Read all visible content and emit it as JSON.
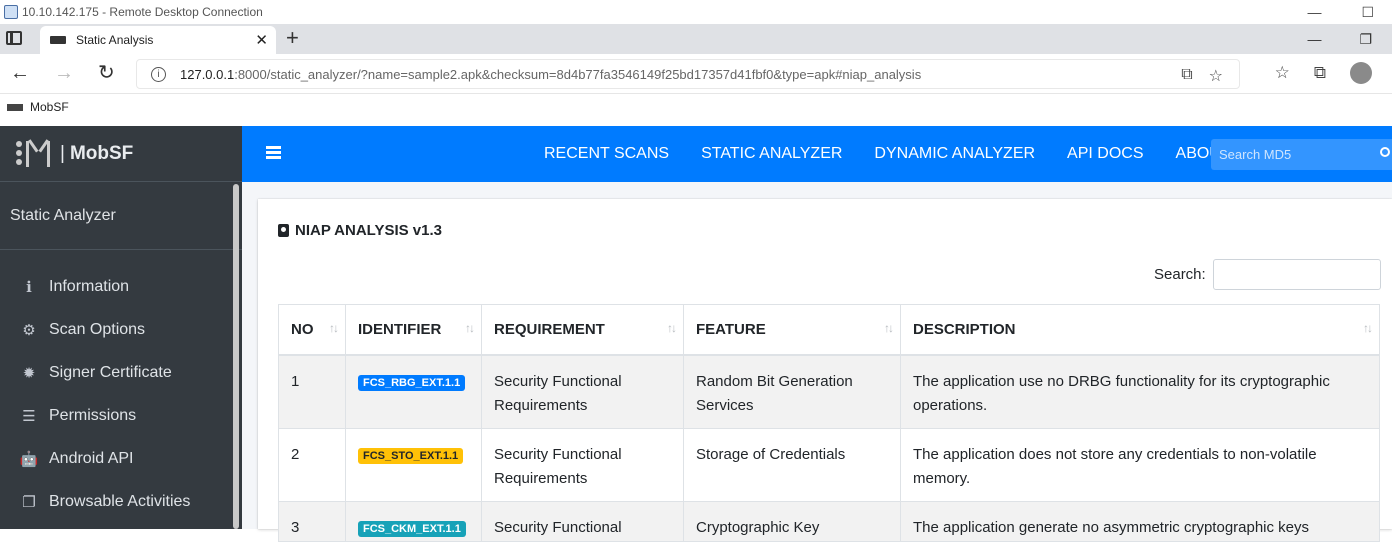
{
  "rdp": {
    "title": "10.10.142.175 - Remote Desktop Connection",
    "min": "—",
    "max": "☐"
  },
  "browser": {
    "tab_title": "Static Analysis",
    "tab_close": "✕",
    "new_tab": "+",
    "win_min": "—",
    "win_restore": "❐",
    "url_host": "127.0.0.1",
    "url_rest": ":8000/static_analyzer/?name=sample2.apk&checksum=8d4b77fa3546149f25bd17357d41fbf0&type=apk#niap_analysis",
    "bookmark": "MobSF",
    "info_glyph": "i",
    "nav_back": "←",
    "nav_forward": "→",
    "nav_reload": "↻",
    "reader_glyph": "⧉",
    "star_add_glyph": "☆",
    "favorites_glyph": "☆",
    "collections_glyph": "⧉"
  },
  "sidebar": {
    "brand_name": "MobSF",
    "brand_sep": "|",
    "section": "Static Analyzer",
    "items": [
      {
        "label": "Information",
        "glyph": "ℹ"
      },
      {
        "label": "Scan Options",
        "glyph": "⚙"
      },
      {
        "label": "Signer Certificate",
        "glyph": "✹"
      },
      {
        "label": "Permissions",
        "glyph": "☰"
      },
      {
        "label": "Android API",
        "glyph": "🤖"
      },
      {
        "label": "Browsable Activities",
        "glyph": "❐"
      }
    ]
  },
  "topnav": {
    "links": [
      "RECENT SCANS",
      "STATIC ANALYZER",
      "DYNAMIC ANALYZER",
      "API DOCS",
      "ABOUT"
    ],
    "search_placeholder": "Search MD5"
  },
  "card": {
    "title": "NIAP ANALYSIS v1.3",
    "search_label": "Search:",
    "sort_glyph": "↑↓",
    "columns": [
      "NO",
      "IDENTIFIER",
      "REQUIREMENT",
      "FEATURE",
      "DESCRIPTION"
    ],
    "rows": [
      {
        "no": "1",
        "identifier": "FCS_RBG_EXT.1.1",
        "badge_color": "#007bff",
        "requirement": "Security Functional Requirements",
        "feature": "Random Bit Generation Services",
        "description": "The application use no DRBG functionality for its cryptographic operations."
      },
      {
        "no": "2",
        "identifier": "FCS_STO_EXT.1.1",
        "badge_color": "#ffc107",
        "requirement": "Security Functional Requirements",
        "feature": "Storage of Credentials",
        "description": "The application does not store any credentials to non-volatile memory."
      },
      {
        "no": "3",
        "identifier": "FCS_CKM_EXT.1.1",
        "badge_color": "#17a2b8",
        "requirement": "Security Functional",
        "feature": "Cryptographic Key",
        "description": "The application generate no asymmetric cryptographic keys"
      }
    ]
  },
  "colors": {
    "primary": "#007bff",
    "sidebar": "#343a40"
  }
}
